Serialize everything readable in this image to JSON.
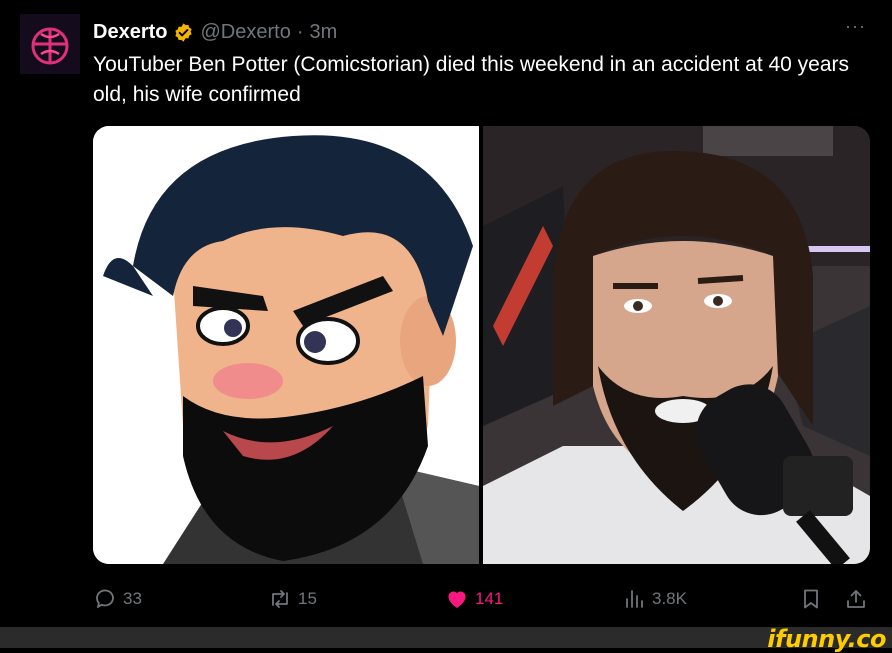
{
  "tweet": {
    "author_name": "Dexerto",
    "handle": "@Dexerto",
    "separator": "·",
    "time": "3m",
    "more": "···",
    "text": "YouTuber Ben Potter (Comicstorian) died this weekend in an accident at 40 years old, his wife confirmed"
  },
  "media": [
    {
      "kind": "illustration",
      "subject": "cartoon-bearded-man"
    },
    {
      "kind": "photo",
      "subject": "bearded-man-with-microphone"
    }
  ],
  "actions": {
    "replies": "33",
    "reposts": "15",
    "likes": "141",
    "views": "3.8K"
  },
  "footer": {
    "watermark": "ifunny.co"
  },
  "colors": {
    "background": "#000000",
    "text": "#e7e9ea",
    "muted": "#71767b",
    "like": "#f91880",
    "verified": "#f4b400",
    "watermark": "#ffcc00"
  },
  "icons": [
    "reply-icon",
    "repost-icon",
    "like-icon",
    "views-icon",
    "bookmark-icon",
    "share-icon",
    "verified-badge-icon",
    "more-icon"
  ]
}
